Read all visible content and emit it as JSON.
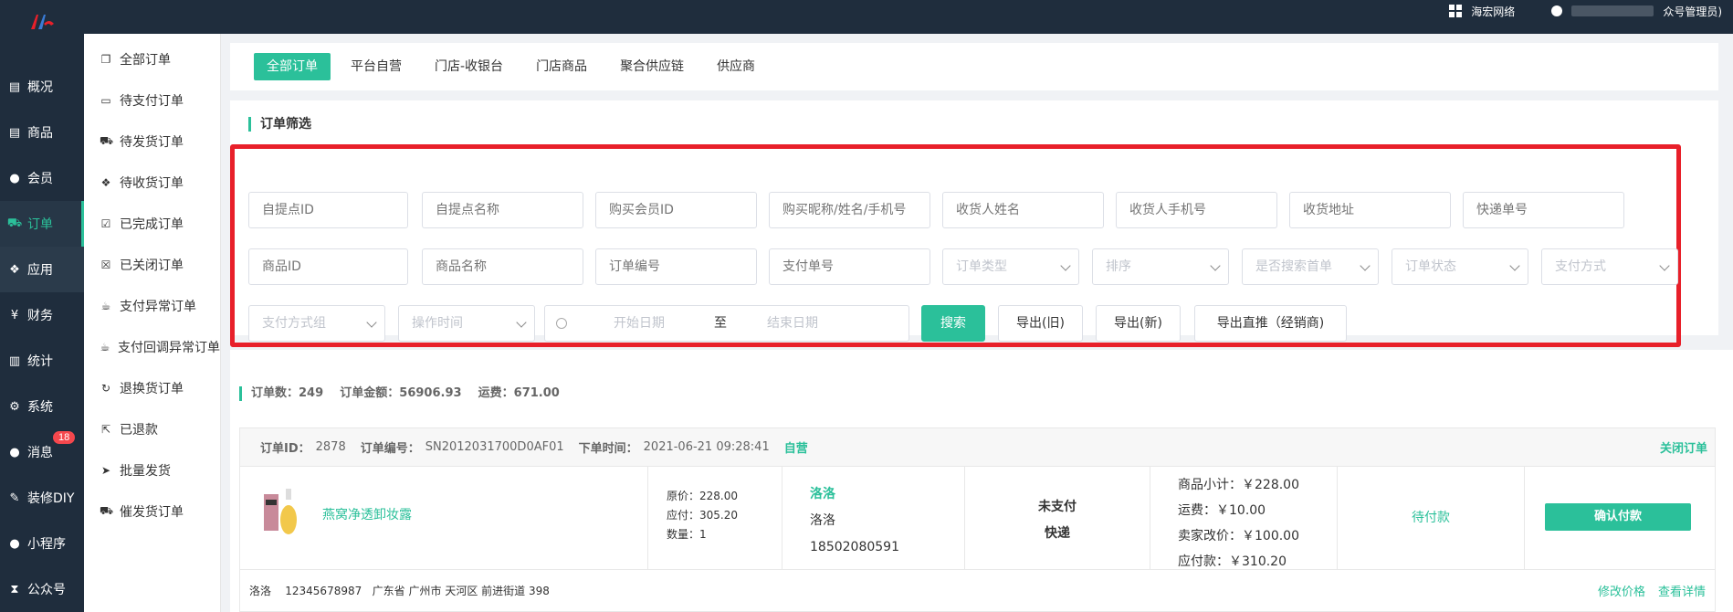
{
  "header": {
    "company": "海宏网络",
    "user_suffix": "众号管理员)"
  },
  "sidebar": {
    "items": [
      {
        "label": "概况",
        "icon": "book-icon"
      },
      {
        "label": "商品",
        "icon": "book-icon"
      },
      {
        "label": "会员",
        "icon": "users-icon"
      },
      {
        "label": "订单",
        "icon": "cart-icon"
      },
      {
        "label": "应用",
        "icon": "cubes-icon"
      },
      {
        "label": "财务",
        "icon": "yen-icon"
      },
      {
        "label": "统计",
        "icon": "bar-chart-icon"
      },
      {
        "label": "系统",
        "icon": "gear-icon"
      },
      {
        "label": "消息",
        "icon": "chat-icon",
        "badge": "18"
      },
      {
        "label": "装修DIY",
        "icon": "tool-icon"
      },
      {
        "label": "小程序",
        "icon": "wechat-icon"
      },
      {
        "label": "公众号",
        "icon": "hourglass-icon"
      }
    ]
  },
  "submenu": {
    "items": [
      {
        "label": "全部订单",
        "icon": "copy-icon"
      },
      {
        "label": "待支付订单",
        "icon": "card-icon"
      },
      {
        "label": "待发货订单",
        "icon": "truck-icon"
      },
      {
        "label": "待收货订单",
        "icon": "dropbox-icon"
      },
      {
        "label": "已完成订单",
        "icon": "check-square-icon"
      },
      {
        "label": "已关闭订单",
        "icon": "close-square-icon"
      },
      {
        "label": "支付异常订单",
        "icon": "cup-icon"
      },
      {
        "label": "支付回调异常订单",
        "icon": "cup-icon"
      },
      {
        "label": "退换货订单",
        "icon": "refresh-icon"
      },
      {
        "label": "已退款",
        "icon": "share-icon"
      },
      {
        "label": "批量发货",
        "icon": "send-icon"
      },
      {
        "label": "催发货订单",
        "icon": "truck-icon"
      }
    ]
  },
  "tabs": [
    "全部订单",
    "平台自营",
    "门店-收银台",
    "门店商品",
    "聚合供应链",
    "供应商"
  ],
  "filter": {
    "title": "订单筛选",
    "row1": [
      "自提点ID",
      "自提点名称",
      "购买会员ID",
      "购买昵称/姓名/手机号",
      "收货人姓名",
      "收货人手机号",
      "收货地址",
      "快递单号"
    ],
    "row2_inputs": [
      "商品ID",
      "商品名称",
      "订单编号",
      "支付单号"
    ],
    "row2_selects": [
      "订单类型",
      "排序",
      "是否搜索首单",
      "订单状态",
      "支付方式"
    ],
    "row3_selects": [
      "支付方式组",
      "操作时间"
    ],
    "date_start": "开始日期",
    "date_sep": "至",
    "date_end": "结束日期",
    "search_btn": "搜索",
    "export_old": "导出(旧)",
    "export_new": "导出(新)",
    "export_direct": "导出直推（经销商)"
  },
  "summary": {
    "count_label": "订单数：",
    "count": "249",
    "amount_label": "订单金额：",
    "amount": "56906.93",
    "freight_label": "运费：",
    "freight": "671.00"
  },
  "order": {
    "id_label": "订单ID：",
    "id": "2878",
    "sn_label": "订单编号：",
    "sn": "SN2012031700D0AF01",
    "time_label": "下单时间：",
    "time": "2021-06-21 09:28:41",
    "tag": "自营",
    "close": "关闭订单",
    "goods_name": "燕窝净透卸妆露",
    "orig_price": "原价：228.00",
    "due_price": "应付：305.20",
    "qty": "数量：1",
    "buyer_nick": "洛洛",
    "buyer_name": "洛洛",
    "buyer_phone": "18502080591",
    "pay_status": "未支付",
    "delivery": "快递",
    "subtotal": "商品小计：￥228.00",
    "freight": "运费：￥10.00",
    "adjust": "卖家改价：￥100.00",
    "payable": "应付款：￥310.20",
    "state": "待付款",
    "confirm_btn": "确认付款",
    "address": "洛洛    12345678987   广东省 广州市 天河区 前进街道 398",
    "edit_price": "修改价格",
    "view_detail": "查看详情"
  }
}
